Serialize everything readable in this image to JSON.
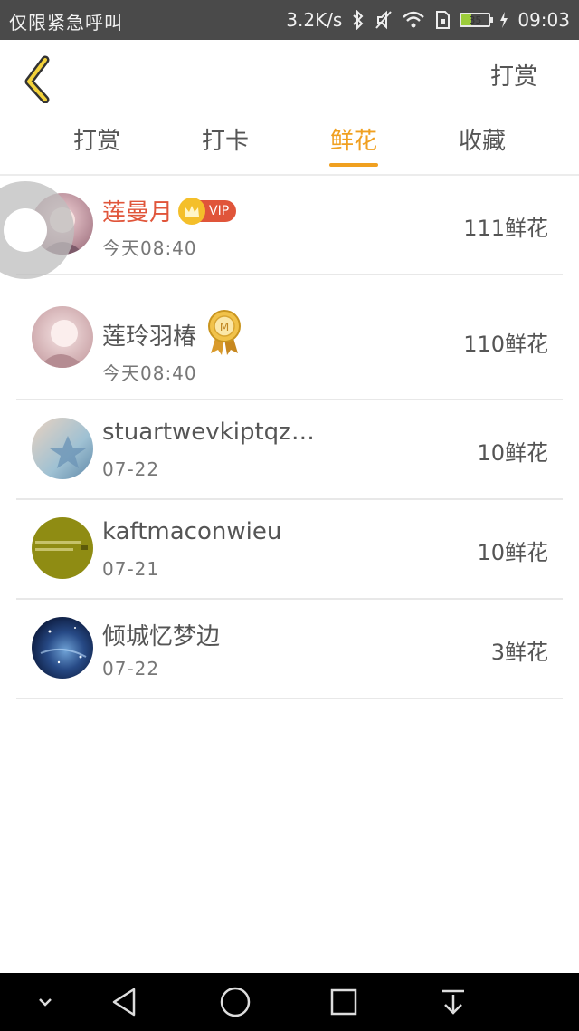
{
  "status_bar": {
    "left_text": "仅限紧急呼叫",
    "net_speed": "3.2K/s",
    "battery": "35",
    "time": "09:03"
  },
  "header": {
    "back_icon": "chevron-left-icon",
    "action_label": "打赏"
  },
  "tabs": [
    {
      "label": "打赏",
      "active": false
    },
    {
      "label": "打卡",
      "active": false
    },
    {
      "label": "鲜花",
      "active": true
    },
    {
      "label": "收藏",
      "active": false
    }
  ],
  "colors": {
    "accent": "#f0a020",
    "vip_name": "#e0553a",
    "status_bg": "#4a4a4a"
  },
  "list": [
    {
      "name": "莲曼月",
      "badge": "VIP",
      "time": "今天08:40",
      "amount": "111鲜花"
    },
    {
      "name": "莲玲羽椿",
      "badge": "medal",
      "time": "今天08:40",
      "amount": "110鲜花"
    },
    {
      "name": "stuartwevkiptqz…",
      "time": "07-22",
      "amount": "10鲜花"
    },
    {
      "name": "kaftmaconwieu",
      "time": "07-21",
      "amount": "10鲜花"
    },
    {
      "name": "倾城忆梦边",
      "time": "07-22",
      "amount": "3鲜花"
    }
  ]
}
